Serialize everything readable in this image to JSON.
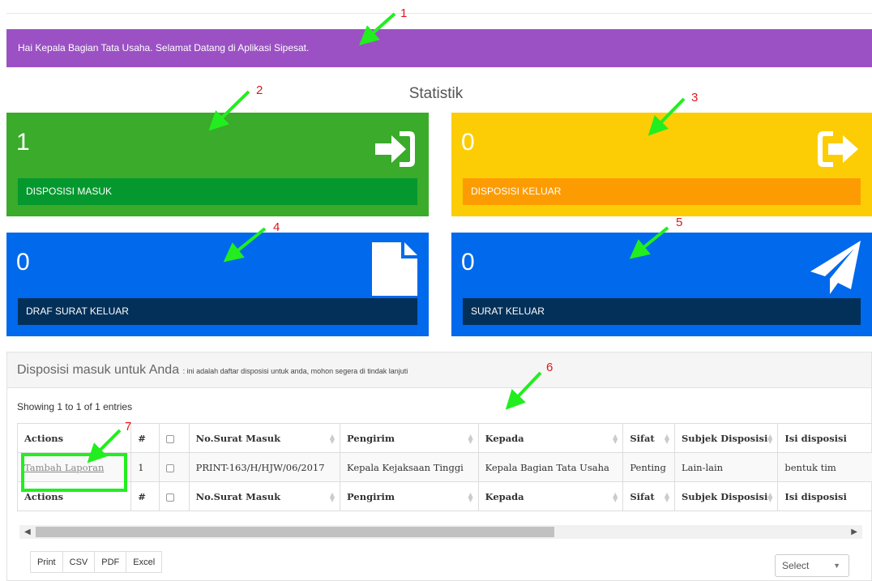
{
  "banner": {
    "text": "Hai Kepala Bagian Tata Usaha. Selamat Datang di Aplikasi Sipesat."
  },
  "statistik": {
    "title": "Statistik"
  },
  "tiles": [
    {
      "value": "1",
      "label": "DISPOSISI MASUK",
      "icon": "sign-in-icon",
      "color": "#3aab2a",
      "bar_color": "#05982f"
    },
    {
      "value": "0",
      "label": "DISPOSISI KELUAR",
      "icon": "sign-out-icon",
      "color": "#fccd04",
      "bar_color": "#fd9c02"
    },
    {
      "value": "0",
      "label": "DRAF SURAT KELUAR",
      "icon": "file-icon",
      "color": "#0069ec",
      "bar_color": "#023059"
    },
    {
      "value": "0",
      "label": "SURAT KELUAR",
      "icon": "paper-plane-icon",
      "color": "#0069ec",
      "bar_color": "#023059"
    }
  ],
  "panel": {
    "title": "Disposisi masuk untuk Anda",
    "subtitle": ": ini adalah daftar disposisi untuk anda, mohon segera di tindak lanjuti",
    "showing": "Showing 1 to 1 of 1 entries"
  },
  "table": {
    "headers": [
      "Actions",
      "#",
      "",
      "No.Surat Masuk",
      "Pengirim",
      "Kepada",
      "Sifat",
      "Subjek Disposisi",
      "Isi disposisi"
    ],
    "row": {
      "action": "Tambah Laporan",
      "no": "1",
      "no_surat": "PRINT-163/H/HJW/06/2017",
      "pengirim": "Kepala Kejaksaan Tinggi",
      "kepada": "Kepala Bagian Tata Usaha",
      "sifat": "Penting",
      "subjek": "Lain-lain",
      "isi": "bentuk tim"
    }
  },
  "export_buttons": [
    "Print",
    "CSV",
    "PDF",
    "Excel"
  ],
  "select": {
    "value": "Select"
  },
  "annotations": [
    "1",
    "2",
    "3",
    "4",
    "5",
    "6",
    "7"
  ],
  "annotation_color": "#e0161c",
  "arrow_color": "#22ee1f"
}
